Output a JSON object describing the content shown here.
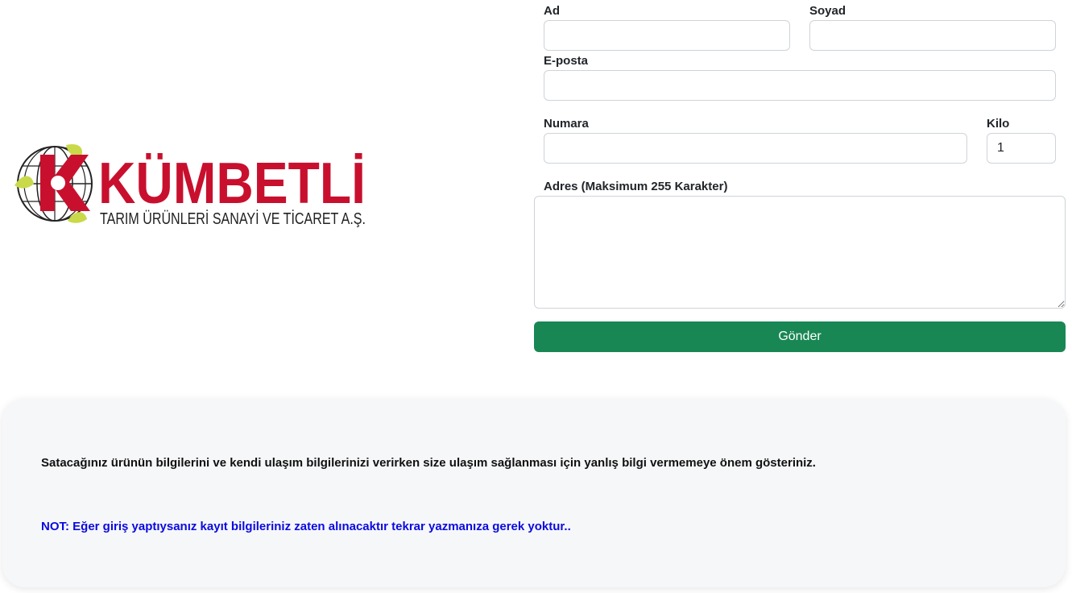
{
  "logo": {
    "brand": "KÜMBETLİ",
    "tagline": "TARIM ÜRÜNLERİ SANAYİ VE TİCARET A.Ş.",
    "colors": {
      "red": "#c8102e",
      "green": "#c9d94a",
      "dark": "#222222"
    }
  },
  "form": {
    "ad_label": "Ad",
    "ad_value": "",
    "soyad_label": "Soyad",
    "soyad_value": "",
    "eposta_label": "E-posta",
    "eposta_value": "",
    "numara_label": "Numara",
    "numara_value": "",
    "kilo_label": "Kilo",
    "kilo_value": "1",
    "adres_label": "Adres (Maksimum 255 Karakter)",
    "adres_value": "",
    "submit_label": "Gönder"
  },
  "info": {
    "message": "Satacağınız ürünün bilgilerini ve kendi ulaşım bilgilerinizi verirken size ulaşım sağlanması için yanlış bilgi vermemeye önem gösteriniz.",
    "note": "NOT: Eğer giriş yaptıysanız kayıt bilgileriniz zaten alınacaktır tekrar yazmanıza gerek yoktur..",
    "note_color": "#0a0ae0"
  },
  "colors": {
    "button": "#198754",
    "card_bg": "#f6f7f9"
  }
}
